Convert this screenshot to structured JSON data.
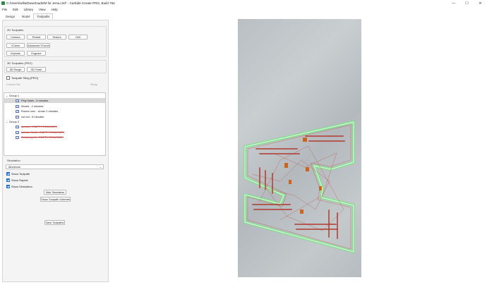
{
  "window": {
    "title": "C:/Users/willa/Downloads/M for Jena.c2d* - Carbide Create PRO, Build 764",
    "controls": {
      "minimize": "—",
      "maximize": "☐",
      "close": "✕"
    }
  },
  "menu": [
    "File",
    "Edit",
    "Library",
    "View",
    "Help"
  ],
  "tabs": [
    {
      "label": "Design",
      "active": false
    },
    {
      "label": "Model",
      "active": false
    },
    {
      "label": "Toolpaths",
      "active": true
    }
  ],
  "toolpaths_2d": {
    "title": "2D Toolpaths",
    "buttons": [
      "Contour",
      "Pocket",
      "Texture",
      "Drill",
      "VCarve",
      "Advanced VCarve",
      "Keyhole",
      "Engrave"
    ]
  },
  "toolpaths_3d": {
    "title": "3D Toolpaths (PRO)",
    "buttons": [
      "3D Rough",
      "3D Finish"
    ]
  },
  "tiling": {
    "label": "Toolpath Tiling (PRO)",
    "checked": false,
    "current_tile": "Current Tile",
    "setup": "Setup"
  },
  "tree": {
    "groups": [
      {
        "name": "Group 1",
        "items": [
          {
            "label": "Peg Holes - 5 minutes",
            "selected": true,
            "disabled": false
          },
          {
            "label": "Words - 2 minutes",
            "selected": false,
            "disabled": false
          },
          {
            "label": "Round over - Under 2 minutes",
            "selected": false,
            "disabled": false
          },
          {
            "label": "cut out - 5 minutes",
            "selected": false,
            "disabled": false
          }
        ]
      },
      {
        "name": "Group 2",
        "items": [
          {
            "label": "surface - EMPTY TOOLPATH",
            "selected": false,
            "disabled": true
          },
          {
            "label": "surface finish - EMPTY TOOLPATH",
            "selected": false,
            "disabled": true
          },
          {
            "label": "Surfacing bit - EMPTY TOOLPATH",
            "selected": false,
            "disabled": true
          }
        ]
      }
    ],
    "expander_open": "⌄"
  },
  "simulation": {
    "title": "Simulation",
    "material": "Aluminum",
    "dropdown_arrow": "⌄",
    "checks": [
      {
        "label": "Show Toolpath",
        "checked": true
      },
      {
        "label": "Show Rapids",
        "checked": true
      },
      {
        "label": "Show Simulation",
        "checked": true
      }
    ],
    "hide_button": "Hide Simulation",
    "volumes_button": "Show Toolpath Volumes"
  },
  "save_button": "Save Toolpaths",
  "colors": {
    "outline_green": "#7ee08a",
    "toolpath_red": "#c0392b",
    "selection_blue": "#1f6fd1"
  }
}
